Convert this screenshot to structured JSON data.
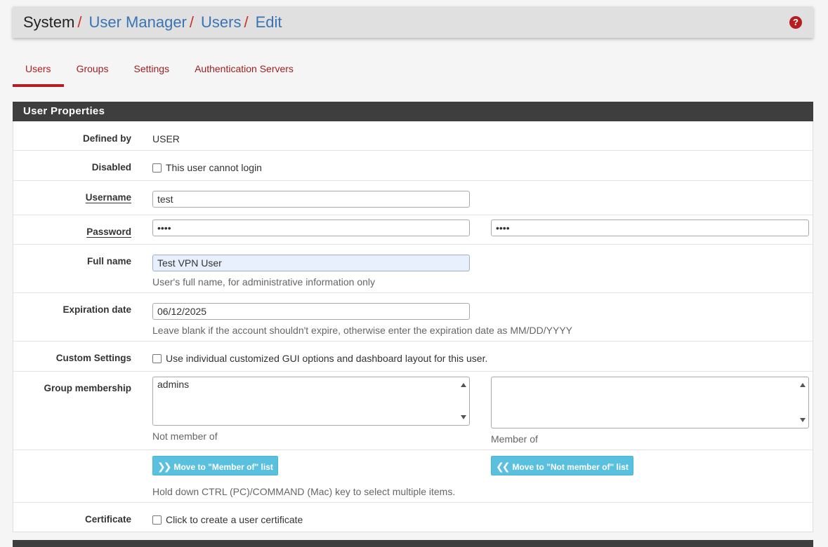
{
  "breadcrumb": {
    "system": "System",
    "user_manager": "User Manager",
    "users": "Users",
    "edit": "Edit",
    "separator": "/"
  },
  "help": "?",
  "tabs": [
    {
      "label": "Users",
      "active": true
    },
    {
      "label": "Groups"
    },
    {
      "label": "Settings"
    },
    {
      "label": "Authentication Servers"
    }
  ],
  "panel": {
    "title": "User Properties"
  },
  "form": {
    "defined_by": {
      "label": "Defined by",
      "value": "USER"
    },
    "disabled": {
      "label": "Disabled",
      "checkbox_text": "This user cannot login"
    },
    "username": {
      "label": "Username",
      "value": "test"
    },
    "password": {
      "label": "Password",
      "value": "••••",
      "confirm": "••••"
    },
    "full_name": {
      "label": "Full name",
      "value": "Test VPN User",
      "hint": "User's full name, for administrative information only"
    },
    "expiration": {
      "label": "Expiration date",
      "value": "06/12/2025",
      "hint": "Leave blank if the account shouldn't expire, otherwise enter the expiration date as MM/DD/YYYY"
    },
    "custom_settings": {
      "label": "Custom Settings",
      "checkbox_text": "Use individual customized GUI options and dashboard layout for this user."
    },
    "group_membership": {
      "label": "Group membership",
      "not_member_items": [
        "admins"
      ],
      "not_member_caption": "Not member of",
      "member_caption": "Member of"
    },
    "move_to_member": "Move to \"Member of\" list",
    "move_to_not_member": "Move to \"Not member of\" list",
    "move_hint": "Hold down CTRL (PC)/COMMAND (Mac) key to select multiple items.",
    "certificate": {
      "label": "Certificate",
      "checkbox_text": "Click to create a user certificate"
    }
  },
  "colors": {
    "accent": "#b51d20",
    "link": "#3a74b4",
    "button": "#5bc0de",
    "panel_head": "#3e3e3e"
  }
}
